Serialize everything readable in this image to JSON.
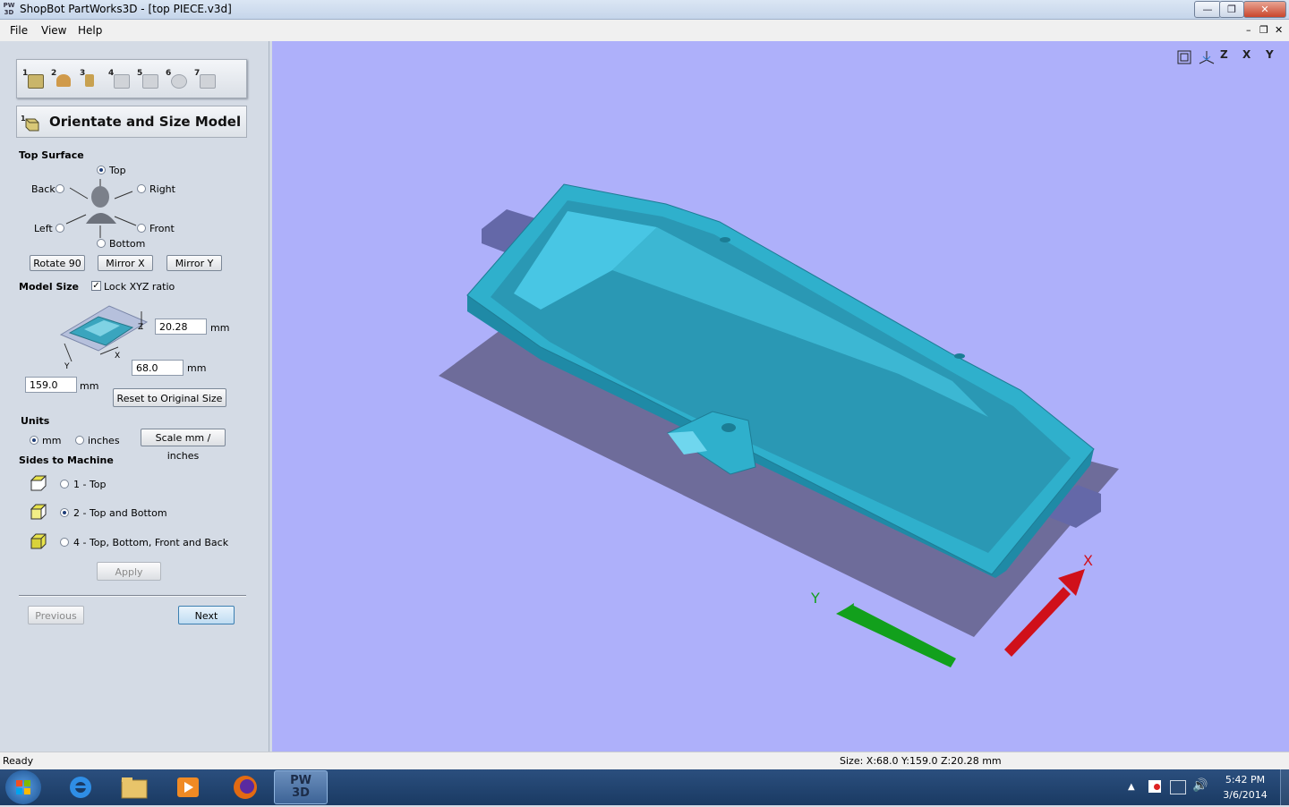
{
  "window": {
    "icon_text": "PW\n3D",
    "title": "ShopBot PartWorks3D - [top PIECE.v3d]",
    "controls": [
      "—",
      "❐",
      "✕"
    ]
  },
  "menu": {
    "items": [
      {
        "label": "File"
      },
      {
        "label": "View"
      },
      {
        "label": "Help"
      }
    ],
    "mdi_controls": [
      "–",
      "❐",
      "✕"
    ]
  },
  "steps": {
    "numbers": [
      "1",
      "2",
      "3",
      "4",
      "5",
      "6",
      "7"
    ],
    "header_number": "1",
    "header_title": "Orientate and Size Model"
  },
  "top_surface": {
    "heading": "Top Surface",
    "options": {
      "top": "Top",
      "back": "Back",
      "right": "Right",
      "left": "Left",
      "front": "Front",
      "bottom": "Bottom"
    },
    "selected": "Top",
    "buttons": {
      "rotate": "Rotate 90",
      "mirror_x": "Mirror X",
      "mirror_y": "Mirror Y"
    }
  },
  "model_size": {
    "heading": "Model Size",
    "lock_label": "Lock XYZ ratio",
    "lock_checked": "✓",
    "axis_z": "Z",
    "axis_x": "X",
    "axis_y": "Y",
    "z_value": "20.28",
    "x_value": "68.0",
    "y_value": "159.0",
    "unit": "mm",
    "reset_label": "Reset to Original Size"
  },
  "units": {
    "heading": "Units",
    "mm_label": "mm",
    "inches_label": "inches",
    "selected": "mm",
    "scale_label": "Scale mm / inches"
  },
  "sides": {
    "heading": "Sides to Machine",
    "options": [
      {
        "label": "1 - Top",
        "selected": false
      },
      {
        "label": "2 - Top and Bottom",
        "selected": true
      },
      {
        "label": "4 - Top, Bottom, Front and Back",
        "selected": false
      }
    ],
    "apply_label": "Apply"
  },
  "nav": {
    "previous_label": "Previous",
    "next_label": "Next"
  },
  "view_toolbar": {
    "buttons": [
      "fit-view-icon",
      "iso-view-icon",
      "top-view-z-icon",
      "front-view-x-icon",
      "side-view-y-icon"
    ],
    "labels": [
      "",
      "",
      "Z",
      "X",
      "Y"
    ]
  },
  "axes": {
    "x_label": "X",
    "y_label": "Y",
    "x_color": "#d0101a",
    "y_color": "#12a01c"
  },
  "colors": {
    "viewport_bg": "#aeb0fa",
    "model": "#2fb0cc",
    "shadow": "#6e6c9a"
  },
  "status": {
    "left": "Ready",
    "size": "Size: X:68.0 Y:159.0 Z:20.28 mm"
  },
  "taskbar": {
    "time": "5:42 PM",
    "date": "3/6/2014",
    "active_app": "PW\n3D"
  }
}
